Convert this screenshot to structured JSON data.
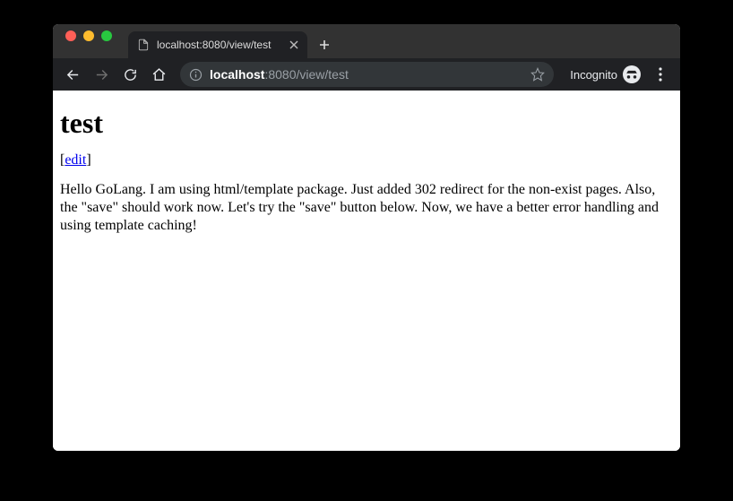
{
  "tab": {
    "title": "localhost:8080/view/test"
  },
  "url": {
    "host": "localhost",
    "rest": ":8080/view/test"
  },
  "incognito_label": "Incognito",
  "page": {
    "heading": "test",
    "edit_link_text": "edit",
    "body": "Hello GoLang. I am using html/template package. Just added 302 redirect for the non-exist pages. Also, the \"save\" should work now. Let's try the \"save\" button below. Now, we have a better error handling and using template caching!"
  }
}
